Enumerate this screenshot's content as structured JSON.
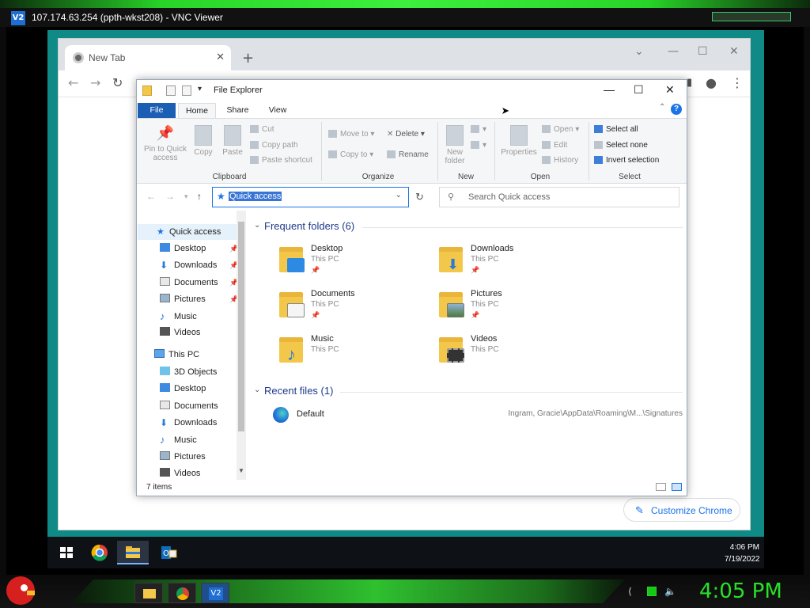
{
  "vnc": {
    "title": "107.174.63.254 (ppth-wkst208) - VNC Viewer",
    "logo": "V2"
  },
  "chrome": {
    "tab_title": "New Tab",
    "new_tab": "+",
    "close": "✕",
    "customize_label": "Customize Chrome"
  },
  "explorer": {
    "title": "File Explorer",
    "ribbon_tabs": [
      "File",
      "Home",
      "Share",
      "View"
    ],
    "ribbon": {
      "pin_quick_access": "Pin to Quick access",
      "copy": "Copy",
      "paste": "Paste",
      "cut": "Cut",
      "copy_path": "Copy path",
      "paste_shortcut": "Paste shortcut",
      "group_clipboard": "Clipboard",
      "move_to": "Move to",
      "copy_to": "Copy to",
      "delete": "Delete",
      "rename": "Rename",
      "group_organize": "Organize",
      "new_folder": "New folder",
      "group_new": "New",
      "properties": "Properties",
      "open": "Open",
      "edit": "Edit",
      "history": "History",
      "group_open": "Open",
      "select_all": "Select all",
      "select_none": "Select none",
      "invert_selection": "Invert selection",
      "group_select": "Select"
    },
    "address": "Quick access",
    "search_placeholder": "Search Quick access",
    "nav": {
      "quick_access": "Quick access",
      "qa_items": [
        "Desktop",
        "Downloads",
        "Documents",
        "Pictures",
        "Music",
        "Videos"
      ],
      "this_pc": "This PC",
      "pc_items": [
        "3D Objects",
        "Desktop",
        "Documents",
        "Downloads",
        "Music",
        "Pictures",
        "Videos"
      ]
    },
    "frequent_header": "Frequent folders (6)",
    "folders": [
      {
        "name": "Desktop",
        "location": "This PC"
      },
      {
        "name": "Downloads",
        "location": "This PC"
      },
      {
        "name": "Documents",
        "location": "This PC"
      },
      {
        "name": "Pictures",
        "location": "This PC"
      },
      {
        "name": "Music",
        "location": "This PC"
      },
      {
        "name": "Videos",
        "location": "This PC"
      }
    ],
    "recent_header": "Recent files (1)",
    "recent": [
      {
        "name": "Default",
        "path": "Ingram, Gracie\\AppData\\Roaming\\M...\\Signatures"
      }
    ],
    "status": "7 items"
  },
  "remote_taskbar": {
    "time": "4:06 PM",
    "date": "7/19/2022"
  },
  "local_taskbar": {
    "time": "4:05 PM"
  },
  "colors": {
    "teal_bg": "#0f8a86",
    "accent": "#1a73e8",
    "clock_green": "#29e029"
  }
}
